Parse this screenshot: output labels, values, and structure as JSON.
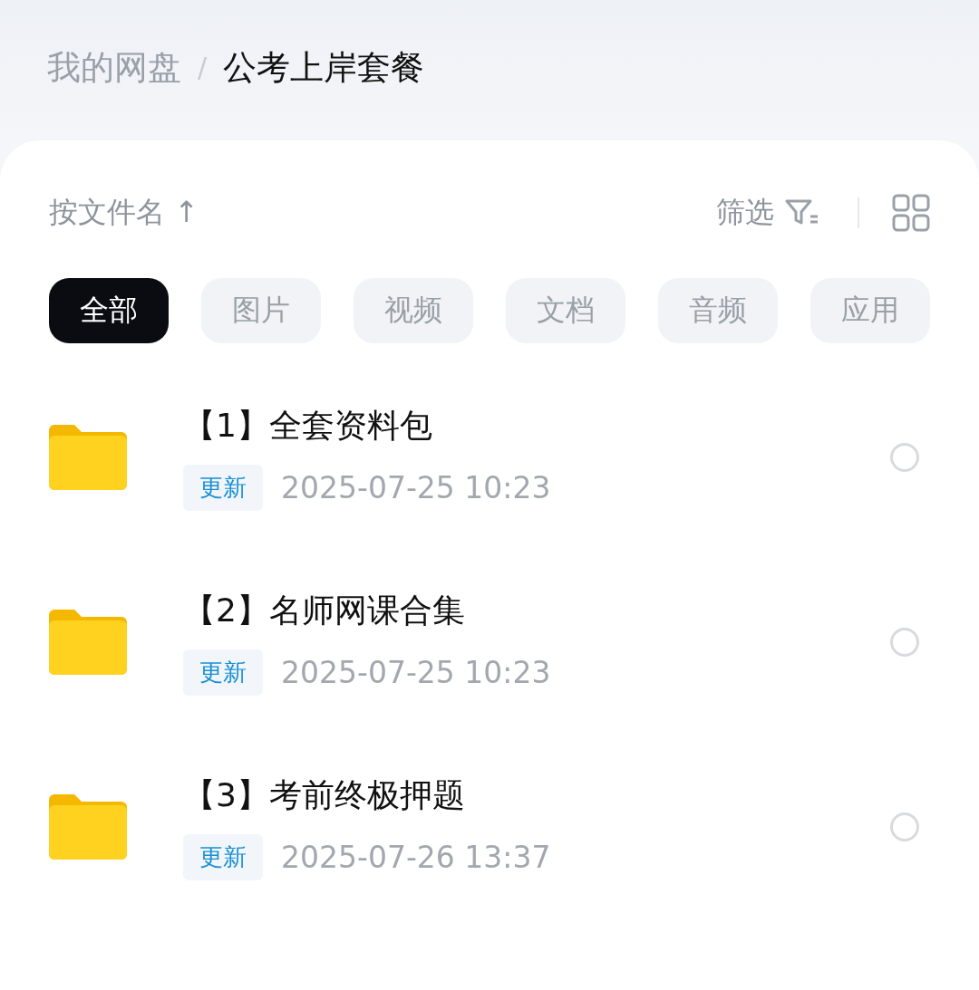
{
  "breadcrumb": [
    {
      "label": "我的网盘",
      "current": false
    },
    {
      "label": "公考上岸套餐",
      "current": true
    }
  ],
  "breadcrumb_separator": "/",
  "sort": {
    "label": "按文件名 ↑"
  },
  "filter": {
    "label": "筛选"
  },
  "chips": [
    {
      "label": "全部",
      "selected": true
    },
    {
      "label": "图片",
      "selected": false
    },
    {
      "label": "视频",
      "selected": false
    },
    {
      "label": "文档",
      "selected": false
    },
    {
      "label": "音频",
      "selected": false
    },
    {
      "label": "应用",
      "selected": false
    }
  ],
  "files": [
    {
      "name": "【1】全套资料包",
      "tag": "更新",
      "time": "2025-07-25  10:23",
      "checked": false
    },
    {
      "name": "【2】名师网课合集",
      "tag": "更新",
      "time": "2025-07-25  10:23",
      "checked": false
    },
    {
      "name": "【3】考前终极押题",
      "tag": "更新",
      "time": "2025-07-26  13:37",
      "checked": false
    }
  ]
}
